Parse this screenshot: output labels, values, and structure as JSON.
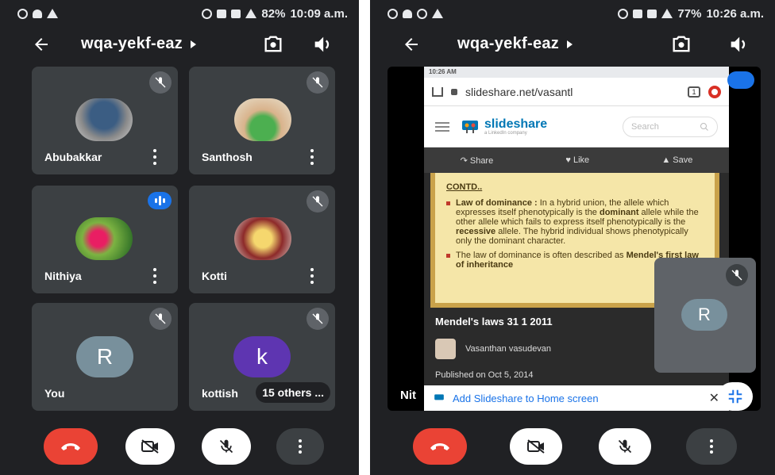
{
  "left": {
    "status": {
      "battery": "82%",
      "time": "10:09 a.m."
    },
    "meeting_code": "wqa-yekf-eaz",
    "participants": [
      {
        "name": "Abubakkar"
      },
      {
        "name": "Santhosh"
      },
      {
        "name": "Nithiya"
      },
      {
        "name": "Kotti"
      },
      {
        "name": "You",
        "initial": "R"
      },
      {
        "name": "kottish",
        "initial": "k",
        "others": "15 others ..."
      }
    ]
  },
  "right": {
    "status": {
      "battery": "77%",
      "time": "10:26 a.m."
    },
    "meeting_code": "wqa-yekf-eaz",
    "shared": {
      "status_time": "10:26 AM",
      "url": "slideshare.net/vasantl",
      "tab_count": "1",
      "logo": "slideshare",
      "logo_sub": "a LinkedIn company",
      "search_placeholder": "Search",
      "actions": {
        "share": "Share",
        "like": "Like",
        "save": "Save"
      },
      "slide": {
        "heading": "CONTD..",
        "para1_bold1": "Law of dominance :",
        "para1": " In a hybrid union, the allele which expresses itself phenotypically is the ",
        "para1_bold2": "dominant",
        "para1_b": " allele while the other allele which fails to express itself phenotypically is the ",
        "para1_bold3": "recessive",
        "para1_c": " allele. The hybrid individual shows phenotypically only the dominant character.",
        "para2": "The law of dominance is often described as ",
        "para2_bold": "Mendel's first law of inheritance"
      },
      "title": "Mendel's laws 31 1 2011",
      "author": "Vasanthan vasudevan",
      "published": "Published on Oct 5, 2014",
      "a2hs": "Add Slideshare to Home screen"
    },
    "pip_initial": "R",
    "presenter_label": "Nit"
  },
  "colors": {
    "bg": "#202124",
    "tile": "#3c4043",
    "end_call": "#ea4335",
    "accent": "#1a73e8"
  }
}
